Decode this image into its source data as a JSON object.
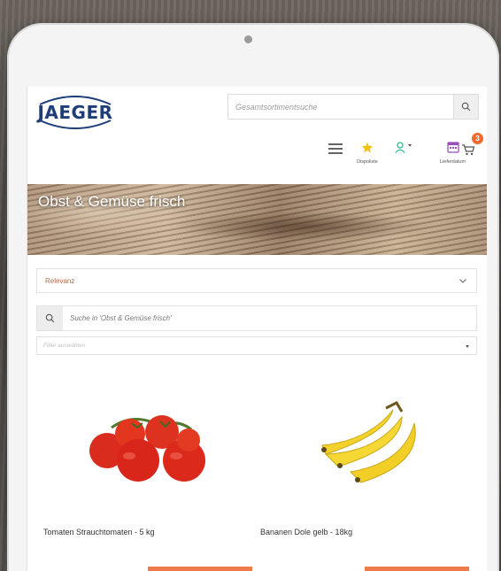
{
  "colors": {
    "brand": "#1e3d79",
    "accent": "#ef7a4a",
    "badge": "#ef6a2e",
    "star": "#f2c21a",
    "user_icon": "#2fb990",
    "calendar_icon": "#9b4fb8"
  },
  "header": {
    "logo_text": "JAEGER",
    "search_placeholder": "Gesamtsortimentsuche",
    "icons": {
      "menu": "hamburger-menu-icon",
      "dispoliste_label": "Dispoliste",
      "user": "user-icon",
      "lieferdatum_label": "Lieferdatum",
      "cart_count": "3"
    }
  },
  "banner": {
    "title": "Obst & Gemüse frisch"
  },
  "controls": {
    "sort_value": "Relevanz",
    "category_search_placeholder": "Suche in 'Obst & Gemüse frisch'",
    "filter_placeholder": "Filter auswählen"
  },
  "products": [
    {
      "name": "Tomaten Strauchtomaten - 5 kg",
      "image": "tomatoes-image"
    },
    {
      "name": "Bananen Dole gelb - 18kg",
      "image": "bananas-image"
    }
  ]
}
